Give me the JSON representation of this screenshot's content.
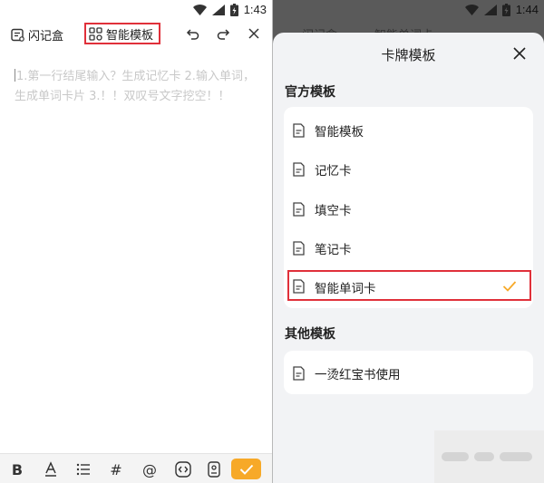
{
  "left": {
    "status": {
      "time": "1:43"
    },
    "toolbar": {
      "memory_box_label": "闪记盒",
      "smart_template_label": "智能模板"
    },
    "editor": {
      "placeholder": "1.第一行结尾输入？生成记忆卡 2.输入单词，生成单词卡片 3.！！双叹号文字挖空！！"
    },
    "format_bar": {
      "bold": "B",
      "hash": "#",
      "at": "@"
    },
    "accent_color": "#f7a928",
    "highlight_color": "#e0303a"
  },
  "right": {
    "status": {
      "time": "1:44"
    },
    "underlay": {
      "memory_box_label": "闪记盒",
      "smart_word_label": "智能单词卡"
    },
    "sheet": {
      "title": "卡牌模板",
      "official_section_title": "官方模板",
      "official_items": [
        {
          "label": "智能模板",
          "selected": false
        },
        {
          "label": "记忆卡",
          "selected": false
        },
        {
          "label": "填空卡",
          "selected": false
        },
        {
          "label": "笔记卡",
          "selected": false
        },
        {
          "label": "智能单词卡",
          "selected": true
        }
      ],
      "other_section_title": "其他模板",
      "other_items": [
        {
          "label": "一烫红宝书使用"
        }
      ]
    }
  }
}
